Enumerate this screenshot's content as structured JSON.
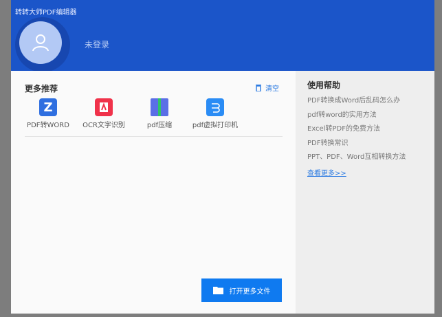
{
  "window": {
    "title": "转转大师PDF编辑器"
  },
  "user": {
    "status": "未登录"
  },
  "recommend": {
    "title": "更多推荐",
    "clear_label": "清空",
    "tools": [
      {
        "label": "PDF转WORD",
        "icon": "word-z-icon",
        "color": "#2f6fe0"
      },
      {
        "label": "OCR文字识别",
        "icon": "ocr-icon",
        "color": "#f0324a"
      },
      {
        "label": "pdf压缩",
        "icon": "zip-folder-icon",
        "color": "#5a6fe6"
      },
      {
        "label": "pdf虚拟打印机",
        "icon": "printer-icon",
        "color": "#2a8cf5"
      }
    ]
  },
  "open_button": {
    "label": "打开更多文件"
  },
  "help": {
    "title": "使用帮助",
    "items": [
      "PDF转换成Word后乱码怎么办",
      "pdf转word的实用方法",
      "Excel转PDF的免费方法",
      "PDF转换常识",
      "PPT、PDF、Word互相转换方法"
    ],
    "more": "查看更多>>"
  }
}
